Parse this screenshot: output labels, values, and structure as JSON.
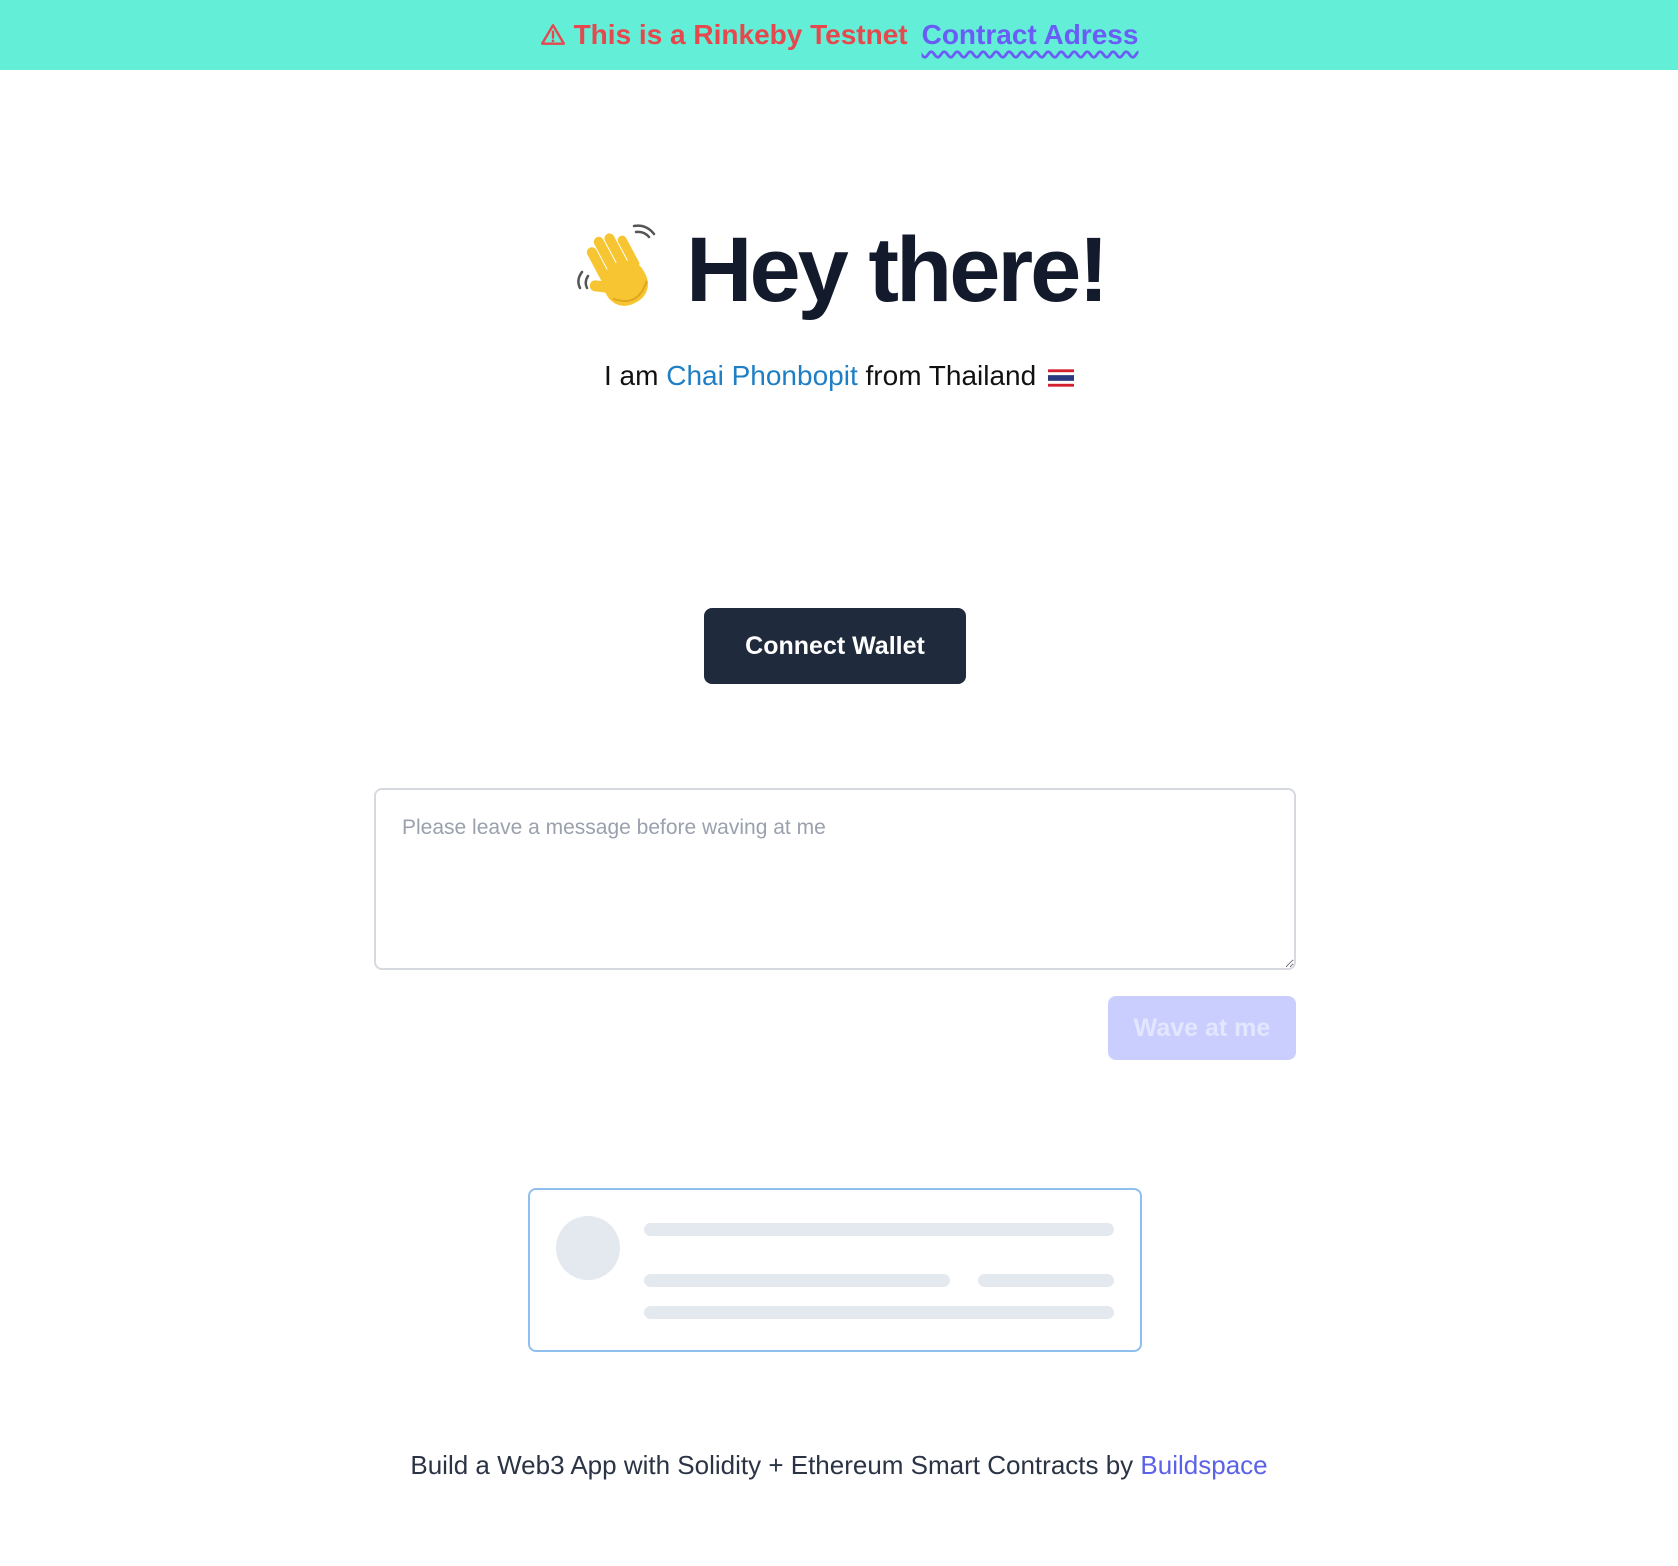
{
  "banner": {
    "warning_icon": "warning-triangle-icon",
    "warning_text": "This is a Rinkeby Testnet",
    "link_label": "Contract Adress",
    "background_color": "#63eed8",
    "warning_color": "#e5484d",
    "link_color": "#6a5cf6"
  },
  "hero": {
    "icon": "waving-hand-icon",
    "title": "Hey there!"
  },
  "intro": {
    "prefix": "I am",
    "name": "Chai Phonbopit",
    "suffix": "from Thailand",
    "flag_icon": "thailand-flag-icon"
  },
  "connect_button": {
    "label": "Connect Wallet",
    "color": "#1f2a3d"
  },
  "message": {
    "value": "",
    "placeholder": "Please leave a message before waving at me"
  },
  "wave_button": {
    "label": "Wave at me",
    "disabled": true,
    "color": "#c9ceff"
  },
  "footer": {
    "text": "Build a Web3 App with Solidity + Ethereum Smart Contracts by",
    "link_label": "Buildspace"
  }
}
